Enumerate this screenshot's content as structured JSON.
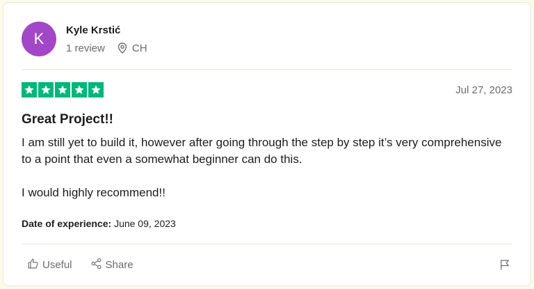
{
  "reviewer": {
    "initial": "K",
    "name": "Kyle Krstić",
    "reviews": "1 review",
    "location": "CH"
  },
  "review": {
    "rating": 5,
    "date": "Jul 27, 2023",
    "title": "Great Project!!",
    "paragraphs": [
      "I am still yet to build it, however after going through the step by step it’s very comprehensive to a point that even a somewhat beginner can do this.",
      "I would highly recommend!!"
    ],
    "experience_label": "Date of experience:",
    "experience_date": "June 09, 2023"
  },
  "actions": {
    "useful_label": "Useful",
    "share_label": "Share"
  },
  "colors": {
    "avatar": "#a147c7",
    "star": "#00b67a"
  }
}
